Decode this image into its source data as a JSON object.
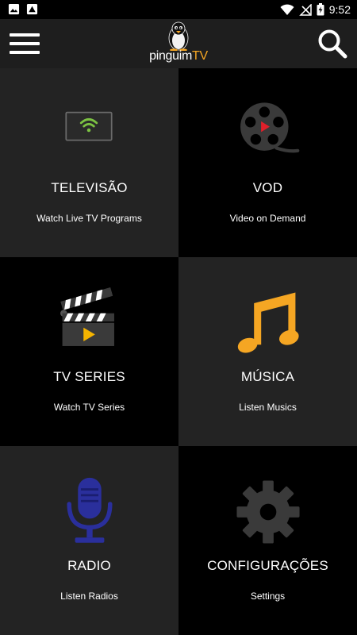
{
  "status_bar": {
    "time": "9:52",
    "icons": [
      "image-notification-icon",
      "photo-notification-icon",
      "wifi-icon",
      "no-signal-icon",
      "battery-charging-icon"
    ]
  },
  "app_bar": {
    "logo_text_main": "pinguim",
    "logo_text_accent": "TV",
    "menu_icon": "hamburger-menu-icon",
    "search_icon": "search-icon"
  },
  "tiles": [
    {
      "title": "TELEVISÃO",
      "subtitle": "Watch Live TV Programs",
      "icon": "tv-wifi-icon",
      "accent": "#7cc242"
    },
    {
      "title": "VOD",
      "subtitle": "Video on Demand",
      "icon": "film-reel-icon",
      "accent": "#e0202a"
    },
    {
      "title": "TV SERIES",
      "subtitle": "Watch TV Series",
      "icon": "clapperboard-icon",
      "accent": "#f5b400"
    },
    {
      "title": "MÚSICA",
      "subtitle": "Listen Musics",
      "icon": "music-note-icon",
      "accent": "#f5a623"
    },
    {
      "title": "RADIO",
      "subtitle": "Listen Radios",
      "icon": "microphone-icon",
      "accent": "#2a2f9c"
    },
    {
      "title": "CONFIGURAÇÕES",
      "subtitle": "Settings",
      "icon": "gear-icon",
      "accent": "#3a3a3a"
    }
  ]
}
